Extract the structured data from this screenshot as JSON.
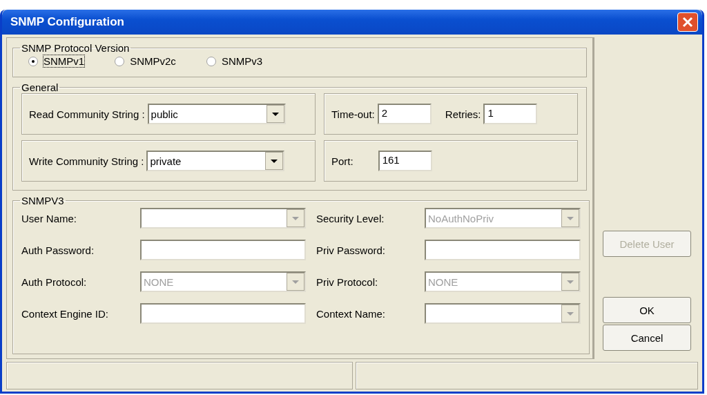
{
  "window": {
    "title": "SNMP Configuration"
  },
  "protocol_version": {
    "legend": "SNMP Protocol Version",
    "options": [
      {
        "label": "SNMPv1",
        "selected": true
      },
      {
        "label": "SNMPv2c",
        "selected": false
      },
      {
        "label": "SNMPv3",
        "selected": false
      }
    ]
  },
  "general": {
    "legend": "General",
    "read_community": {
      "label": "Read Community String :",
      "value": "public"
    },
    "write_community": {
      "label": "Write Community String :",
      "value": "private"
    },
    "timeout": {
      "label": "Time-out:",
      "value": "2"
    },
    "retries": {
      "label": "Retries:",
      "value": "1"
    },
    "port": {
      "label": "Port:",
      "value": "161"
    }
  },
  "snmpv3": {
    "legend": "SNMPV3",
    "fields": [
      {
        "label": "User Name:",
        "kind": "combo",
        "disabled": true
      },
      {
        "label": "Security Level:",
        "kind": "combo",
        "value": "NoAuthNoPriv",
        "disabled": true
      },
      {
        "label": "Auth Password:",
        "kind": "text",
        "disabled": false
      },
      {
        "label": "Priv Password:",
        "kind": "text",
        "disabled": false
      },
      {
        "label": "Auth Protocol:",
        "kind": "combo",
        "value": "NONE",
        "disabled": true
      },
      {
        "label": "Priv Protocol:",
        "kind": "combo",
        "value": "NONE",
        "disabled": true
      },
      {
        "label": "Context Engine ID:",
        "kind": "text",
        "disabled": false
      },
      {
        "label": "Context Name:",
        "kind": "combo",
        "disabled": true
      }
    ]
  },
  "buttons": [
    {
      "label": "Delete User",
      "disabled": true
    },
    {
      "label": "OK",
      "disabled": false
    },
    {
      "label": "Cancel",
      "disabled": false
    }
  ]
}
